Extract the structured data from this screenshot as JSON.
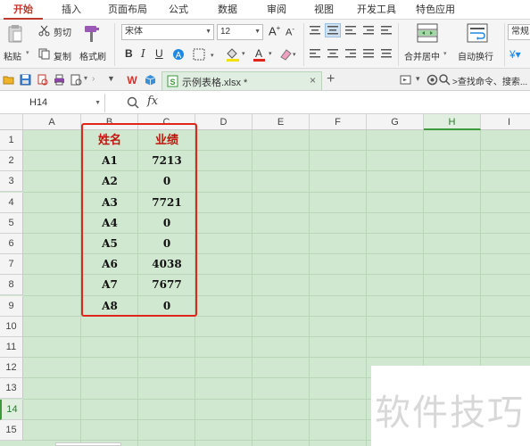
{
  "tabs": [
    "开始",
    "插入",
    "页面布局",
    "公式",
    "数据",
    "审阅",
    "视图",
    "开发工具",
    "特色应用"
  ],
  "ribbon": {
    "paste": "粘贴",
    "cut": "剪切",
    "copy": "复制",
    "format_painter": "格式刷",
    "font_name": "宋体",
    "font_size": "12",
    "bold": "B",
    "italic": "I",
    "underline": "U",
    "merge_center": "合并居中",
    "wrap_text": "自动换行",
    "number_format": "常规"
  },
  "quickbar": {
    "doc_name": "示例表格.xlsx *",
    "search_placeholder": ">查找命令、搜索..."
  },
  "formula_bar": {
    "cell_ref": "H14",
    "fx_label": "fx",
    "value": ""
  },
  "columns": [
    "A",
    "B",
    "C",
    "D",
    "E",
    "F",
    "G",
    "H",
    "I"
  ],
  "rows": [
    "1",
    "2",
    "3",
    "4",
    "5",
    "6",
    "7",
    "8",
    "9",
    "10",
    "11",
    "12",
    "13",
    "14",
    "15"
  ],
  "table": {
    "headers": [
      "姓名",
      "业绩"
    ],
    "data": [
      [
        "A1",
        "7213"
      ],
      [
        "A2",
        "0"
      ],
      [
        "A3",
        "7721"
      ],
      [
        "A4",
        "0"
      ],
      [
        "A5",
        "0"
      ],
      [
        "A6",
        "4038"
      ],
      [
        "A7",
        "7677"
      ],
      [
        "A8",
        "0"
      ]
    ]
  },
  "watermark": "软件技巧",
  "colors": {
    "accent": "#c0392b",
    "grid_bg": "#cfe8cf",
    "highlight_box": "#e0251b"
  }
}
